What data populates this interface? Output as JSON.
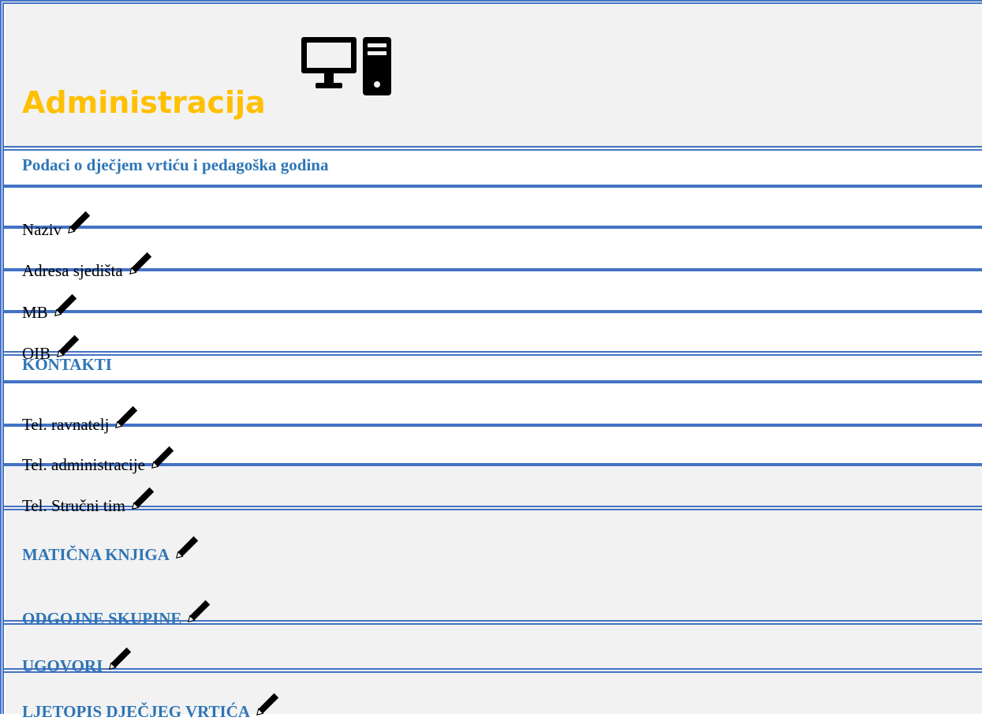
{
  "header": {
    "title": "Administracija",
    "icon": "desktop-computer-icon",
    "title_color": "#ffc000"
  },
  "sections": {
    "info_heading": "Podaci o dječjem vrtiću i pedagoška godina",
    "info_rows": [
      "Naziv",
      "Adresa sjedišta",
      "MB",
      "OIB"
    ],
    "contacts_heading": "KONTAKTI",
    "contacts_rows": [
      "Tel. ravnatelj",
      "Tel. administracije",
      "Tel. Stručni tim"
    ],
    "maticna": "MATIČNA KNJIGA",
    "skupine": "ODGOJNE SKUPINE",
    "ugovori": "UGOVORI",
    "ljetopis": "LJETOPIS DJEČJEG VRTIĆA"
  },
  "icons": {
    "edit": "pencil-icon"
  },
  "colors": {
    "accent": "#4472c4",
    "heading": "#2e75b6",
    "background": "#f2f2f2"
  }
}
